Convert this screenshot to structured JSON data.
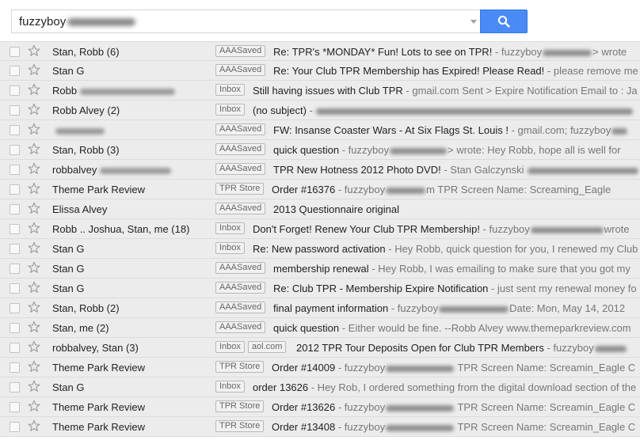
{
  "search": {
    "query": "fuzzyboy",
    "button_icon": "search-icon",
    "colors": {
      "button": "#4a8af4"
    }
  },
  "colors": {
    "row_background": "#ececec",
    "row_border": "#dcdcdc",
    "label_border": "#b9b9b9",
    "snippet_text": "#777777"
  },
  "rows": [
    {
      "sender": "Stan, Robb (6)",
      "labels": [
        "AAASaved"
      ],
      "subject": "Re: TPR's *MONDAY* Fun! Lots to see on TPR!",
      "snippet_pre": " - fuzzyboy",
      "snippet_post": "> wrote"
    },
    {
      "sender": "Stan G",
      "labels": [
        "AAASaved"
      ],
      "subject": "Re: Your Club TPR Membership has Expired! Please Read!",
      "snippet_pre": " - please remove me",
      "snippet_post": ""
    },
    {
      "sender": "Robb",
      "labels": [
        "Inbox"
      ],
      "subject": "Still having issues with Club TPR",
      "snippet_pre": " - gmail.com Sent > Expire Notification Email to : Ja",
      "snippet_post": ""
    },
    {
      "sender": "Robb Alvey (2)",
      "labels": [
        "Inbox"
      ],
      "subject": "(no subject)",
      "snippet_pre": " - ",
      "snippet_post": ""
    },
    {
      "sender": "",
      "labels": [
        "AAASaved"
      ],
      "subject": "FW: Insanse Coaster Wars - At Six Flags St. Louis !",
      "snippet_pre": " - gmail.com; fuzzyboy",
      "snippet_post": ""
    },
    {
      "sender": "Stan, Robb (3)",
      "labels": [
        "AAASaved"
      ],
      "subject": "quick question",
      "snippet_pre": " - fuzzyboy",
      "snippet_post": "> wrote: Hey Robb, hope all is well for"
    },
    {
      "sender": "robbalvey",
      "labels": [
        "AAASaved"
      ],
      "subject": "TPR New Hotness 2012 Photo DVD!",
      "snippet_pre": " - Stan Galczynski ",
      "snippet_post": ""
    },
    {
      "sender": "Theme Park Review",
      "labels": [
        "TPR Store"
      ],
      "subject": "Order #16376",
      "snippet_pre": " - fuzzyboy",
      "snippet_post": "m TPR Screen Name: Screaming_Eagle"
    },
    {
      "sender": "Elissa Alvey",
      "labels": [
        "AAASaved"
      ],
      "subject": "2013 Questionnaire original",
      "snippet_pre": "",
      "snippet_post": ""
    },
    {
      "sender": "Robb .. Joshua, Stan, me (18)",
      "labels": [
        "Inbox"
      ],
      "subject": "Don't Forget! Renew Your Club TPR Membership!",
      "snippet_pre": " - fuzzyboy",
      "snippet_post": "wrote"
    },
    {
      "sender": "Stan G",
      "labels": [
        "Inbox"
      ],
      "subject": "Re: New password activation",
      "snippet_pre": " - Hey Robb, quick question for you, I renewed my Club",
      "snippet_post": ""
    },
    {
      "sender": "Stan G",
      "labels": [
        "AAASaved"
      ],
      "subject": "membership renewal",
      "snippet_pre": " - Hey Robb, I was emailing to make sure that you got my",
      "snippet_post": ""
    },
    {
      "sender": "Stan G",
      "labels": [
        "AAASaved"
      ],
      "subject": "Re: Club TPR - Membership Expire Notification",
      "snippet_pre": " - just sent my renewal money fo",
      "snippet_post": ""
    },
    {
      "sender": "Stan, Robb (2)",
      "labels": [
        "AAASaved"
      ],
      "subject": "final payment information",
      "snippet_pre": " - fuzzyboy",
      "snippet_post": "Date: Mon, May 14, 2012"
    },
    {
      "sender": "Stan, me (2)",
      "labels": [
        "AAASaved"
      ],
      "subject": "quick question",
      "snippet_pre": " - Either would be fine. --Robb Alvey www.themeparkreview.com",
      "snippet_post": ""
    },
    {
      "sender": "robbalvey, Stan (3)",
      "labels": [
        "Inbox",
        "aol.com"
      ],
      "subject": "2012 TPR Tour Deposits Open for Club TPR Members",
      "snippet_pre": " - fuzzyboy",
      "snippet_post": ""
    },
    {
      "sender": "Theme Park Review",
      "labels": [
        "TPR Store"
      ],
      "subject": "Order #14009",
      "snippet_pre": " - fuzzyboy",
      "snippet_post": " TPR Screen Name: Screamin_Eagle C"
    },
    {
      "sender": "Stan G",
      "labels": [
        "Inbox"
      ],
      "subject": "order 13626",
      "snippet_pre": " - Hey Rob, I ordered something from the digital download section of the",
      "snippet_post": ""
    },
    {
      "sender": "Theme Park Review",
      "labels": [
        "TPR Store"
      ],
      "subject": "Order #13626",
      "snippet_pre": " - fuzzyboy",
      "snippet_post": " TPR Screen Name: Screamin_Eagle C"
    },
    {
      "sender": "Theme Park Review",
      "labels": [
        "TPR Store"
      ],
      "subject": "Order #13408",
      "snippet_pre": " - fuzzyboy",
      "snippet_post": " TPR Screen Name: Screamin_Eagle C"
    }
  ]
}
